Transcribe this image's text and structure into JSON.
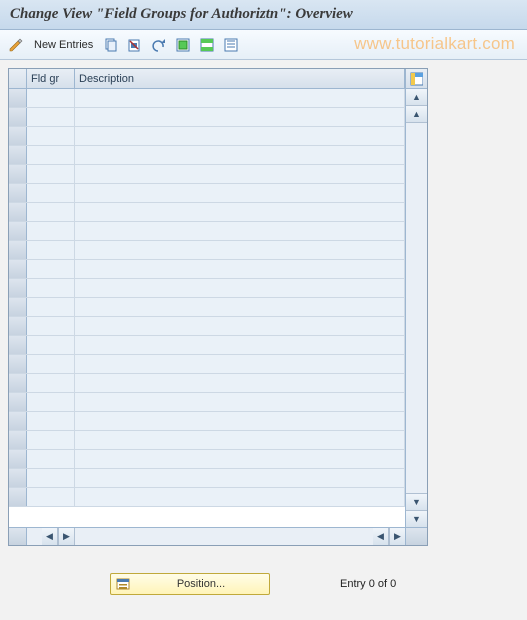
{
  "title": "Change View \"Field Groups for Authoriztn\": Overview",
  "toolbar": {
    "new_entries_label": "New Entries"
  },
  "watermark": "www.tutorialkart.com",
  "grid": {
    "columns": {
      "fldgr": "Fld gr",
      "description": "Description"
    },
    "rows": [
      {
        "fldgr": "",
        "description": ""
      },
      {
        "fldgr": "",
        "description": ""
      },
      {
        "fldgr": "",
        "description": ""
      },
      {
        "fldgr": "",
        "description": ""
      },
      {
        "fldgr": "",
        "description": ""
      },
      {
        "fldgr": "",
        "description": ""
      },
      {
        "fldgr": "",
        "description": ""
      },
      {
        "fldgr": "",
        "description": ""
      },
      {
        "fldgr": "",
        "description": ""
      },
      {
        "fldgr": "",
        "description": ""
      },
      {
        "fldgr": "",
        "description": ""
      },
      {
        "fldgr": "",
        "description": ""
      },
      {
        "fldgr": "",
        "description": ""
      },
      {
        "fldgr": "",
        "description": ""
      },
      {
        "fldgr": "",
        "description": ""
      },
      {
        "fldgr": "",
        "description": ""
      },
      {
        "fldgr": "",
        "description": ""
      },
      {
        "fldgr": "",
        "description": ""
      },
      {
        "fldgr": "",
        "description": ""
      },
      {
        "fldgr": "",
        "description": ""
      },
      {
        "fldgr": "",
        "description": ""
      },
      {
        "fldgr": "",
        "description": ""
      }
    ]
  },
  "footer": {
    "position_label": "Position...",
    "entry_text": "Entry 0 of 0"
  }
}
